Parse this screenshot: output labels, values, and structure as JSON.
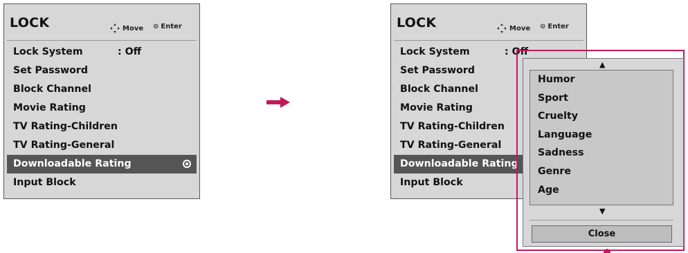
{
  "left_menu": {
    "title": "LOCK",
    "hint_move": "Move",
    "hint_enter": "Enter",
    "items": [
      {
        "label": "Lock System",
        "value": ": Off"
      },
      {
        "label": "Set Password",
        "value": ""
      },
      {
        "label": "Block Channel",
        "value": ""
      },
      {
        "label": "Movie Rating",
        "value": ""
      },
      {
        "label": "TV Rating-Children",
        "value": ""
      },
      {
        "label": "TV Rating-General",
        "value": ""
      },
      {
        "label": "Downloadable Rating",
        "value": ""
      },
      {
        "label": "Input Block",
        "value": ""
      }
    ]
  },
  "right_menu": {
    "title": "LOCK",
    "hint_move": "Move",
    "hint_enter": "Enter",
    "items": [
      {
        "label": "Lock System",
        "value": ": Off"
      },
      {
        "label": "Set Password",
        "value": ""
      },
      {
        "label": "Block Channel",
        "value": ""
      },
      {
        "label": "Movie Rating",
        "value": ""
      },
      {
        "label": "TV Rating-Children",
        "value": ""
      },
      {
        "label": "TV Rating-General",
        "value": ""
      },
      {
        "label": "Downloadable Rating",
        "value": ""
      },
      {
        "label": "Input Block",
        "value": ""
      }
    ]
  },
  "popup": {
    "options": [
      "Humor",
      "Sport",
      "Cruelty",
      "Language",
      "Sadness",
      "Genre",
      "Age"
    ],
    "close_label": "Close"
  },
  "colors": {
    "panel_bg": "#d7d7d7",
    "selected_bg": "#555555",
    "accent": "#c2185b"
  }
}
